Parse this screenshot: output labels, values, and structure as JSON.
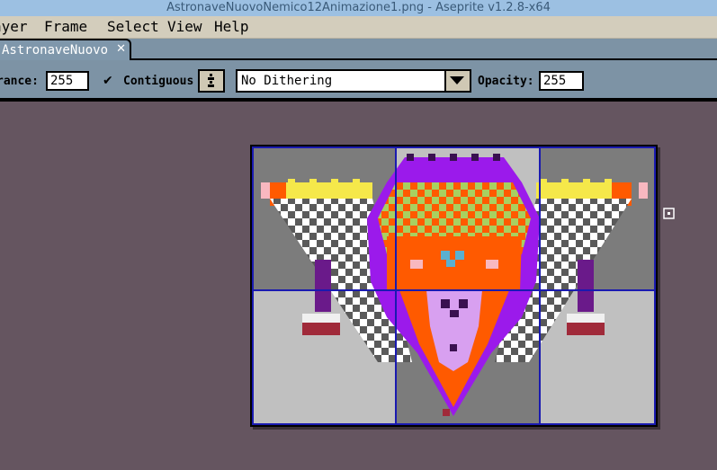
{
  "window": {
    "title": "AstronaveNuovoNemico12Animazione1.png - Aseprite v1.2.8-x64"
  },
  "menubar": {
    "items": [
      {
        "label": "Layer",
        "visible": "ayer"
      },
      {
        "label": "Frame"
      },
      {
        "label": "Select"
      },
      {
        "label": "View"
      },
      {
        "label": "Help"
      }
    ]
  },
  "tabs": [
    {
      "label": "AstronaveNuovo",
      "close_icon": "close-icon"
    }
  ],
  "toolbar": {
    "tolerance_label": "rance:",
    "tolerance_value": "255",
    "contiguous_label": "Contiguous",
    "contiguous_checked": true,
    "dithering_value": "No Dithering",
    "opacity_label": "Opacity:",
    "opacity_value": "255"
  },
  "colors": {
    "titlebar": "#9cc0e2",
    "menubar": "#d3cdbc",
    "toolbar": "#7d93a5",
    "workspace": "#655560",
    "grid": "#1a1ab0",
    "purple": "#9b1aeb",
    "orange": "#ff5a00",
    "lilac": "#d8a0f0",
    "yellow": "#f5e84a",
    "green": "#a8d060",
    "dark_red": "#a02a3a"
  },
  "icons": [
    "close-icon",
    "checkmark-icon",
    "tolerance-button-icon",
    "dropdown-arrow-icon",
    "cursor-icon"
  ]
}
